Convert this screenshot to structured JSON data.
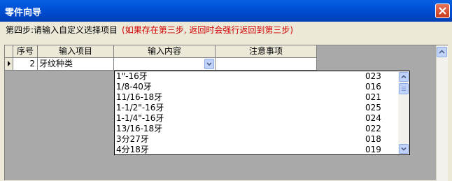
{
  "window": {
    "title": "零件向导"
  },
  "step": {
    "text": "第四步:请输入自定义选择项目",
    "note": "(如果存在第三步, 返回时会强行返回到第三步)"
  },
  "grid": {
    "columns": [
      "序号",
      "输入项目",
      "输入内容",
      "注意事项"
    ],
    "rows": [
      {
        "index": "2",
        "item": "牙纹种类",
        "value": "",
        "note": ""
      }
    ]
  },
  "dropdown": {
    "options": [
      {
        "name": "1\"-16牙",
        "code": "023"
      },
      {
        "name": "1/8-40牙",
        "code": "016"
      },
      {
        "name": "11/16-18牙",
        "code": "021"
      },
      {
        "name": "1-1/2\"-16牙",
        "code": "025"
      },
      {
        "name": "1-1/4\"-16牙",
        "code": "024"
      },
      {
        "name": "13/16-18牙",
        "code": "022"
      },
      {
        "name": "3分27牙",
        "code": "018"
      },
      {
        "name": "4分18牙",
        "code": "019"
      }
    ]
  },
  "icons": {
    "close": "close-icon",
    "row_pointer": "row-pointer-icon",
    "dropdown": "chevron-down-icon"
  },
  "colors": {
    "titlebar": "#0054e3",
    "note": "#d00000",
    "close": "#d9502f"
  }
}
